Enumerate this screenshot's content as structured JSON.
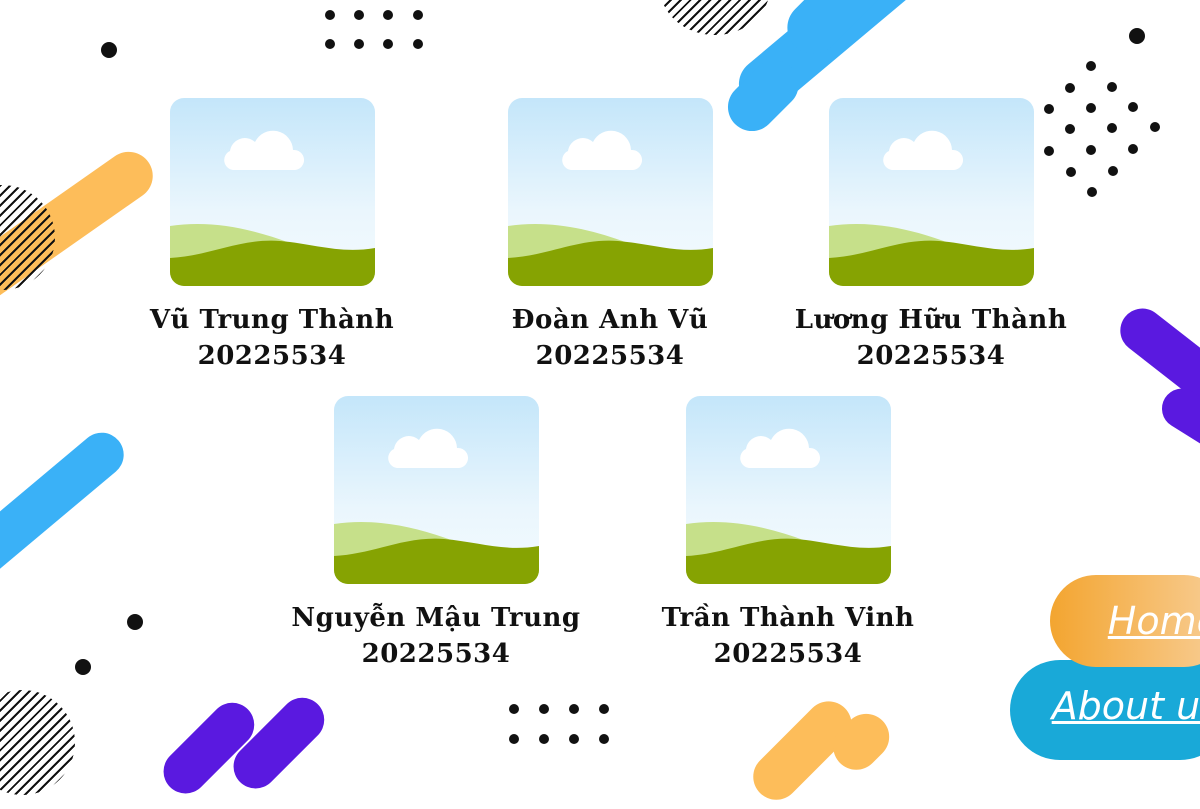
{
  "members": [
    {
      "name": "Vũ Trung Thành",
      "student_id": "20225534"
    },
    {
      "name": "Đoàn Anh Vũ",
      "student_id": "20225534"
    },
    {
      "name": "Lương Hữu Thành",
      "student_id": "20225534"
    },
    {
      "name": "Nguyễn Mậu Trung",
      "student_id": "20225534"
    },
    {
      "name": "Trần Thành Vinh",
      "student_id": "20225534"
    }
  ],
  "nav": {
    "home_label": "Home",
    "about_label": "About us"
  },
  "colors": {
    "blue": "#3ab1f7",
    "orange": "#fdbd5a",
    "purple": "#5a19e0",
    "home_start": "#f3a530",
    "about_bg": "#19a9d8"
  },
  "icons": {
    "photo": "landscape-placeholder-icon"
  }
}
